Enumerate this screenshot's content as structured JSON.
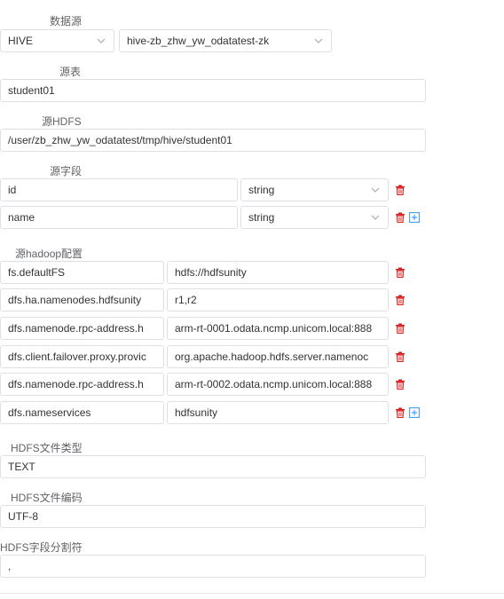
{
  "datasource": {
    "label": "数据源",
    "type_value": "HIVE",
    "instance_value": "hive-zb_zhw_yw_odatatest-zk"
  },
  "source_table": {
    "label": "源表",
    "value": "student01"
  },
  "source_hdfs": {
    "label": "源HDFS",
    "value": "/user/zb_zhw_yw_odatatest/tmp/hive/student01"
  },
  "source_fields": {
    "label": "源字段",
    "rows": [
      {
        "name": "id",
        "type": "string"
      },
      {
        "name": "name",
        "type": "string"
      }
    ]
  },
  "hadoop_config": {
    "label": "源hadoop配置",
    "rows": [
      {
        "key": "fs.defaultFS",
        "value": "hdfs://hdfsunity"
      },
      {
        "key": "dfs.ha.namenodes.hdfsunity",
        "value": "r1,r2"
      },
      {
        "key": "dfs.namenode.rpc-address.h",
        "value": "arm-rt-0001.odata.ncmp.unicom.local:888"
      },
      {
        "key": "dfs.client.failover.proxy.provic",
        "value": "org.apache.hadoop.hdfs.server.namenoc"
      },
      {
        "key": "dfs.namenode.rpc-address.h",
        "value": "arm-rt-0002.odata.ncmp.unicom.local:888"
      },
      {
        "key": "dfs.nameservices",
        "value": "hdfsunity"
      }
    ]
  },
  "hdfs_file_type": {
    "label": "HDFS文件类型",
    "value": "TEXT"
  },
  "hdfs_file_encoding": {
    "label": "HDFS文件编码",
    "value": "UTF-8"
  },
  "hdfs_field_delimiter": {
    "label": "HDFS字段分割符",
    "value": ","
  },
  "icons": {
    "delete": "trash-icon",
    "add": "plus-square-icon",
    "dropdown": "chevron-down-icon",
    "delete_color": "#e02020",
    "add_color": "#409eff"
  }
}
